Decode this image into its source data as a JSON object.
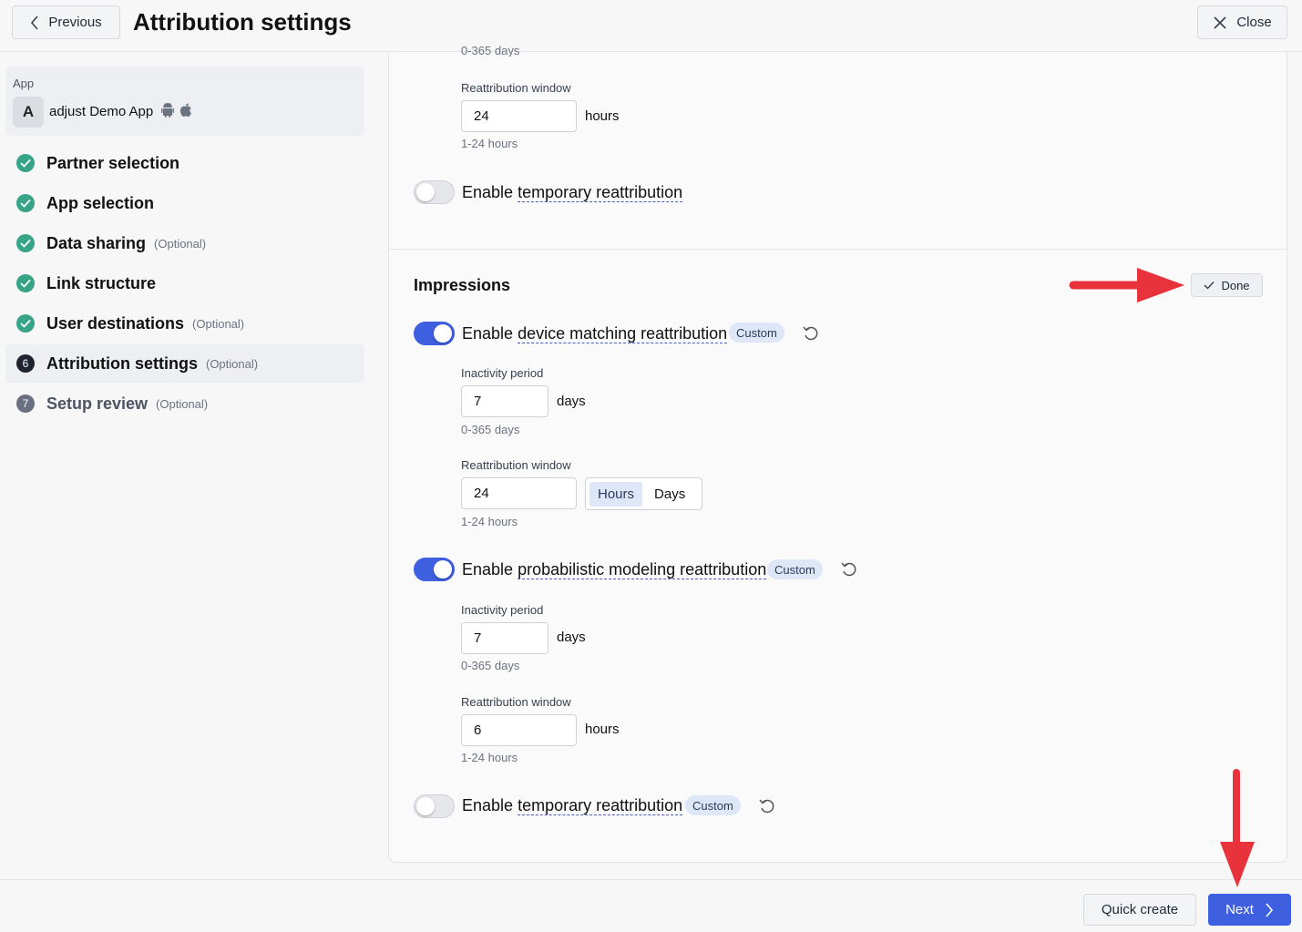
{
  "header": {
    "previous_label": "Previous",
    "title": "Attribution settings",
    "close_label": "Close"
  },
  "app": {
    "label": "App",
    "avatar": "A",
    "name": "adjust Demo App",
    "platform_icons": [
      "android-icon",
      "apple-icon"
    ]
  },
  "steps": [
    {
      "label": "Partner selection",
      "optional": "",
      "status": "done"
    },
    {
      "label": "App selection",
      "optional": "",
      "status": "done"
    },
    {
      "label": "Data sharing",
      "optional": "(Optional)",
      "status": "done"
    },
    {
      "label": "Link structure",
      "optional": "",
      "status": "done"
    },
    {
      "label": "User destinations",
      "optional": "(Optional)",
      "status": "done"
    },
    {
      "label": "Attribution settings",
      "optional": "(Optional)",
      "status": "active",
      "number": "6"
    },
    {
      "label": "Setup review",
      "optional": "(Optional)",
      "status": "pending",
      "number": "7"
    }
  ],
  "top_section": {
    "cut_hint": "0-365 days",
    "reattribution_label": "Reattribution window",
    "reattribution_value": "24",
    "reattribution_unit": "hours",
    "reattribution_hint": "1-24 hours",
    "temp_toggle_prefix": "Enable ",
    "temp_toggle_term": "temporary reattribution",
    "temp_toggle_on": false
  },
  "impressions": {
    "title": "Impressions",
    "done_label": "Done",
    "device_matching": {
      "prefix": "Enable ",
      "term": "device matching reattribution",
      "on": true,
      "badge": "Custom",
      "inactivity_label": "Inactivity period",
      "inactivity_value": "7",
      "inactivity_unit": "days",
      "inactivity_hint": "0-365 days",
      "window_label": "Reattribution window",
      "window_value": "24",
      "window_options": [
        "Hours",
        "Days"
      ],
      "window_selected": "Hours",
      "window_hint": "1-24 hours"
    },
    "probabilistic": {
      "prefix": "Enable ",
      "term": "probabilistic modeling reattribution",
      "on": true,
      "badge": "Custom",
      "inactivity_label": "Inactivity period",
      "inactivity_value": "7",
      "inactivity_unit": "days",
      "inactivity_hint": "0-365 days",
      "window_label": "Reattribution window",
      "window_value": "6",
      "window_unit": "hours",
      "window_hint": "1-24 hours"
    },
    "temporary": {
      "prefix": "Enable ",
      "term": "temporary reattribution",
      "on": false,
      "badge": "Custom"
    }
  },
  "footer": {
    "quick_create_label": "Quick create",
    "next_label": "Next"
  },
  "colors": {
    "accent": "#3d5fe0",
    "success": "#37a488",
    "annotation_arrow": "#e8323c",
    "badge_bg": "#dde7f7"
  }
}
